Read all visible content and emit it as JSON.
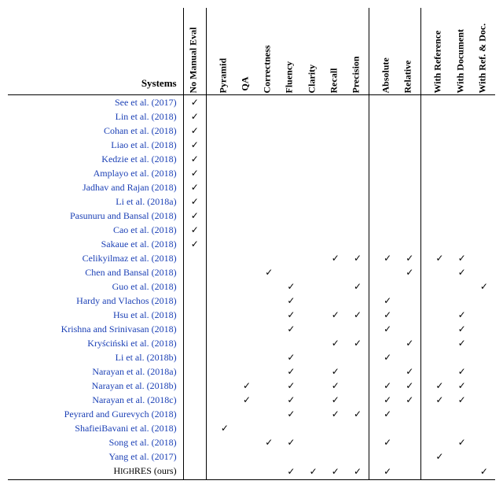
{
  "header": {
    "systems": "Systems",
    "cols": [
      "No Manual Eval",
      "Pyramid",
      "QA",
      "Correctness",
      "Fluency",
      "Clarity",
      "Recall",
      "Precision",
      "Absolute",
      "Relative",
      "With Reference",
      "With Document",
      "With Ref. & Doc."
    ]
  },
  "check": "✓",
  "rows": [
    {
      "label": "See et al. (2017)",
      "link": true,
      "marks": [
        true,
        false,
        false,
        false,
        false,
        false,
        false,
        false,
        false,
        false,
        false,
        false,
        false
      ]
    },
    {
      "label": "Lin et al. (2018)",
      "link": true,
      "marks": [
        true,
        false,
        false,
        false,
        false,
        false,
        false,
        false,
        false,
        false,
        false,
        false,
        false
      ]
    },
    {
      "label": "Cohan et al. (2018)",
      "link": true,
      "marks": [
        true,
        false,
        false,
        false,
        false,
        false,
        false,
        false,
        false,
        false,
        false,
        false,
        false
      ]
    },
    {
      "label": "Liao et al. (2018)",
      "link": true,
      "marks": [
        true,
        false,
        false,
        false,
        false,
        false,
        false,
        false,
        false,
        false,
        false,
        false,
        false
      ]
    },
    {
      "label": "Kedzie et al. (2018)",
      "link": true,
      "marks": [
        true,
        false,
        false,
        false,
        false,
        false,
        false,
        false,
        false,
        false,
        false,
        false,
        false
      ]
    },
    {
      "label": "Amplayo et al. (2018)",
      "link": true,
      "marks": [
        true,
        false,
        false,
        false,
        false,
        false,
        false,
        false,
        false,
        false,
        false,
        false,
        false
      ]
    },
    {
      "label": "Jadhav and Rajan (2018)",
      "link": true,
      "marks": [
        true,
        false,
        false,
        false,
        false,
        false,
        false,
        false,
        false,
        false,
        false,
        false,
        false
      ]
    },
    {
      "label": "Li et al. (2018a)",
      "link": true,
      "marks": [
        true,
        false,
        false,
        false,
        false,
        false,
        false,
        false,
        false,
        false,
        false,
        false,
        false
      ]
    },
    {
      "label": "Pasunuru and Bansal (2018)",
      "link": true,
      "marks": [
        true,
        false,
        false,
        false,
        false,
        false,
        false,
        false,
        false,
        false,
        false,
        false,
        false
      ]
    },
    {
      "label": "Cao et al. (2018)",
      "link": true,
      "marks": [
        true,
        false,
        false,
        false,
        false,
        false,
        false,
        false,
        false,
        false,
        false,
        false,
        false
      ]
    },
    {
      "label": "Sakaue et al. (2018)",
      "link": true,
      "marks": [
        true,
        false,
        false,
        false,
        false,
        false,
        false,
        false,
        false,
        false,
        false,
        false,
        false
      ]
    },
    {
      "label": "Celikyilmaz et al. (2018)",
      "link": true,
      "marks": [
        false,
        false,
        false,
        false,
        false,
        false,
        true,
        true,
        true,
        true,
        true,
        true,
        false
      ]
    },
    {
      "label": "Chen and Bansal (2018)",
      "link": true,
      "marks": [
        false,
        false,
        false,
        true,
        false,
        false,
        false,
        false,
        false,
        true,
        false,
        true,
        false
      ]
    },
    {
      "label": "Guo et al. (2018)",
      "link": true,
      "marks": [
        false,
        false,
        false,
        false,
        true,
        false,
        false,
        true,
        false,
        false,
        false,
        false,
        true
      ]
    },
    {
      "label": "Hardy and Vlachos (2018)",
      "link": true,
      "marks": [
        false,
        false,
        false,
        false,
        true,
        false,
        false,
        false,
        true,
        false,
        false,
        false,
        false
      ]
    },
    {
      "label": "Hsu et al. (2018)",
      "link": true,
      "marks": [
        false,
        false,
        false,
        false,
        true,
        false,
        true,
        true,
        true,
        false,
        false,
        true,
        false
      ]
    },
    {
      "label": "Krishna and Srinivasan (2018)",
      "link": true,
      "marks": [
        false,
        false,
        false,
        false,
        true,
        false,
        false,
        false,
        true,
        false,
        false,
        true,
        false
      ]
    },
    {
      "label": "Kryściński et al. (2018)",
      "link": true,
      "marks": [
        false,
        false,
        false,
        false,
        false,
        false,
        true,
        true,
        false,
        true,
        false,
        true,
        false
      ]
    },
    {
      "label": "Li et al. (2018b)",
      "link": true,
      "marks": [
        false,
        false,
        false,
        false,
        true,
        false,
        false,
        false,
        true,
        false,
        false,
        false,
        false
      ]
    },
    {
      "label": "Narayan et al. (2018a)",
      "link": true,
      "marks": [
        false,
        false,
        false,
        false,
        true,
        false,
        true,
        false,
        false,
        true,
        false,
        true,
        false
      ]
    },
    {
      "label": "Narayan et al. (2018b)",
      "link": true,
      "marks": [
        false,
        false,
        true,
        false,
        true,
        false,
        true,
        false,
        true,
        true,
        true,
        true,
        false
      ]
    },
    {
      "label": "Narayan et al. (2018c)",
      "link": true,
      "marks": [
        false,
        false,
        true,
        false,
        true,
        false,
        true,
        false,
        true,
        true,
        true,
        true,
        false
      ]
    },
    {
      "label": "Peyrard and Gurevych (2018)",
      "link": true,
      "marks": [
        false,
        false,
        false,
        false,
        true,
        false,
        true,
        true,
        true,
        false,
        false,
        false,
        false
      ]
    },
    {
      "label": "ShafieiBavani et al. (2018)",
      "link": true,
      "marks": [
        false,
        true,
        false,
        false,
        false,
        false,
        false,
        false,
        false,
        false,
        false,
        false,
        false
      ]
    },
    {
      "label": "Song et al. (2018)",
      "link": true,
      "marks": [
        false,
        false,
        false,
        true,
        true,
        false,
        false,
        false,
        true,
        false,
        false,
        true,
        false
      ]
    },
    {
      "label": "Yang et al. (2017)",
      "link": true,
      "marks": [
        false,
        false,
        false,
        false,
        false,
        false,
        false,
        false,
        false,
        false,
        true,
        false,
        false
      ]
    },
    {
      "label": "HIGHRES (ours)",
      "link": false,
      "marks": [
        false,
        false,
        false,
        false,
        true,
        true,
        true,
        true,
        true,
        false,
        false,
        false,
        true
      ]
    }
  ]
}
